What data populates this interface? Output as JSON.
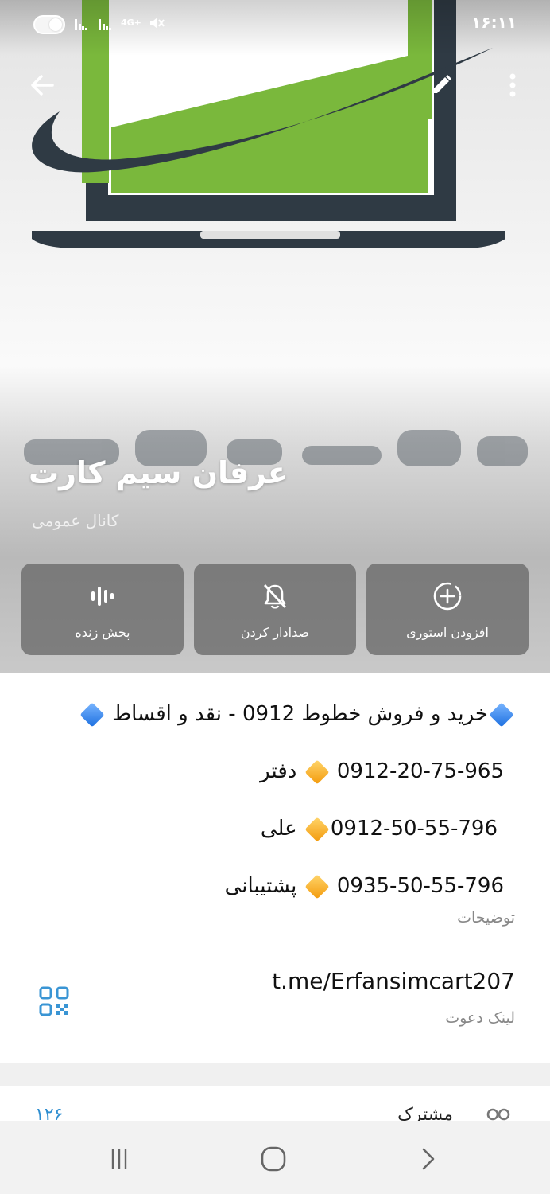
{
  "status_bar": {
    "time": "۱۶:۱۱",
    "network": "4G+"
  },
  "header": {
    "back_icon": "arrow-left-icon",
    "edit_icon": "pencil-icon",
    "more_icon": "more-vertical-icon",
    "cover_image": {
      "accent_color": "#7ab83c",
      "frame_color": "#2f3a44",
      "logo_text": "موبایل عرفان"
    }
  },
  "channel": {
    "title": "عرفان سیم کارت",
    "subtitle": "کانال عمومی"
  },
  "actions": [
    {
      "label": "پخش زنده",
      "icon": "live-stream-icon"
    },
    {
      "label": "صدادار کردن",
      "icon": "bell-off-icon"
    },
    {
      "label": "افزودن استوری",
      "icon": "add-story-icon"
    }
  ],
  "description": {
    "line1": "خرید و فروش خطوط 0912 - نقد و اقساط",
    "line2_number": "0912-20-75-965",
    "line2_name": "دفتر",
    "line3_number": "0912-50-55-796",
    "line3_name": "علی",
    "line4_number": "0935-50-55-796",
    "line4_name": "پشتیبانی",
    "label": "توضیحات"
  },
  "invite": {
    "link": "t.me/Erfansimcart207",
    "label": "لینک دعوت",
    "qr_icon": "qr-code-icon"
  },
  "members": {
    "count": "۱۲۶",
    "label": "مشترک"
  },
  "nav": {
    "recent_icon": "recent-apps-icon",
    "home_icon": "home-icon",
    "back_icon": "nav-back-icon"
  }
}
